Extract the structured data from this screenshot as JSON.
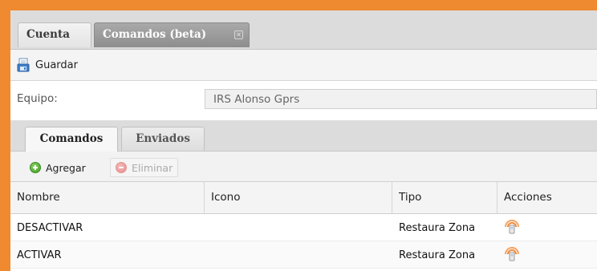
{
  "tabs": [
    {
      "label": "Cuenta"
    },
    {
      "label": "Comandos (beta)",
      "close_icon": "close-icon"
    }
  ],
  "toolbar": {
    "save_label": "Guardar",
    "save_icon": "save-icon"
  },
  "equipo": {
    "label": "Equipo:",
    "value": "IRS Alonso Gprs"
  },
  "inner_tabs": [
    {
      "label": "Comandos"
    },
    {
      "label": "Enviados"
    }
  ],
  "grid_toolbar": {
    "add_label": "Agregar",
    "add_icon": "add-icon",
    "delete_label": "Eliminar",
    "delete_icon": "remove-icon"
  },
  "grid": {
    "columns": [
      "Nombre",
      "Icono",
      "Tipo",
      "Acciones"
    ],
    "rows": [
      {
        "nombre": "DESACTIVAR",
        "icono": "",
        "tipo": "Restaura Zona",
        "accion_icon": "send-command-icon"
      },
      {
        "nombre": "ACTIVAR",
        "icono": "",
        "tipo": "Restaura Zona",
        "accion_icon": "send-command-icon"
      }
    ]
  },
  "colors": {
    "frame": "#f08a30",
    "active_tab": "#9a9a9a"
  }
}
